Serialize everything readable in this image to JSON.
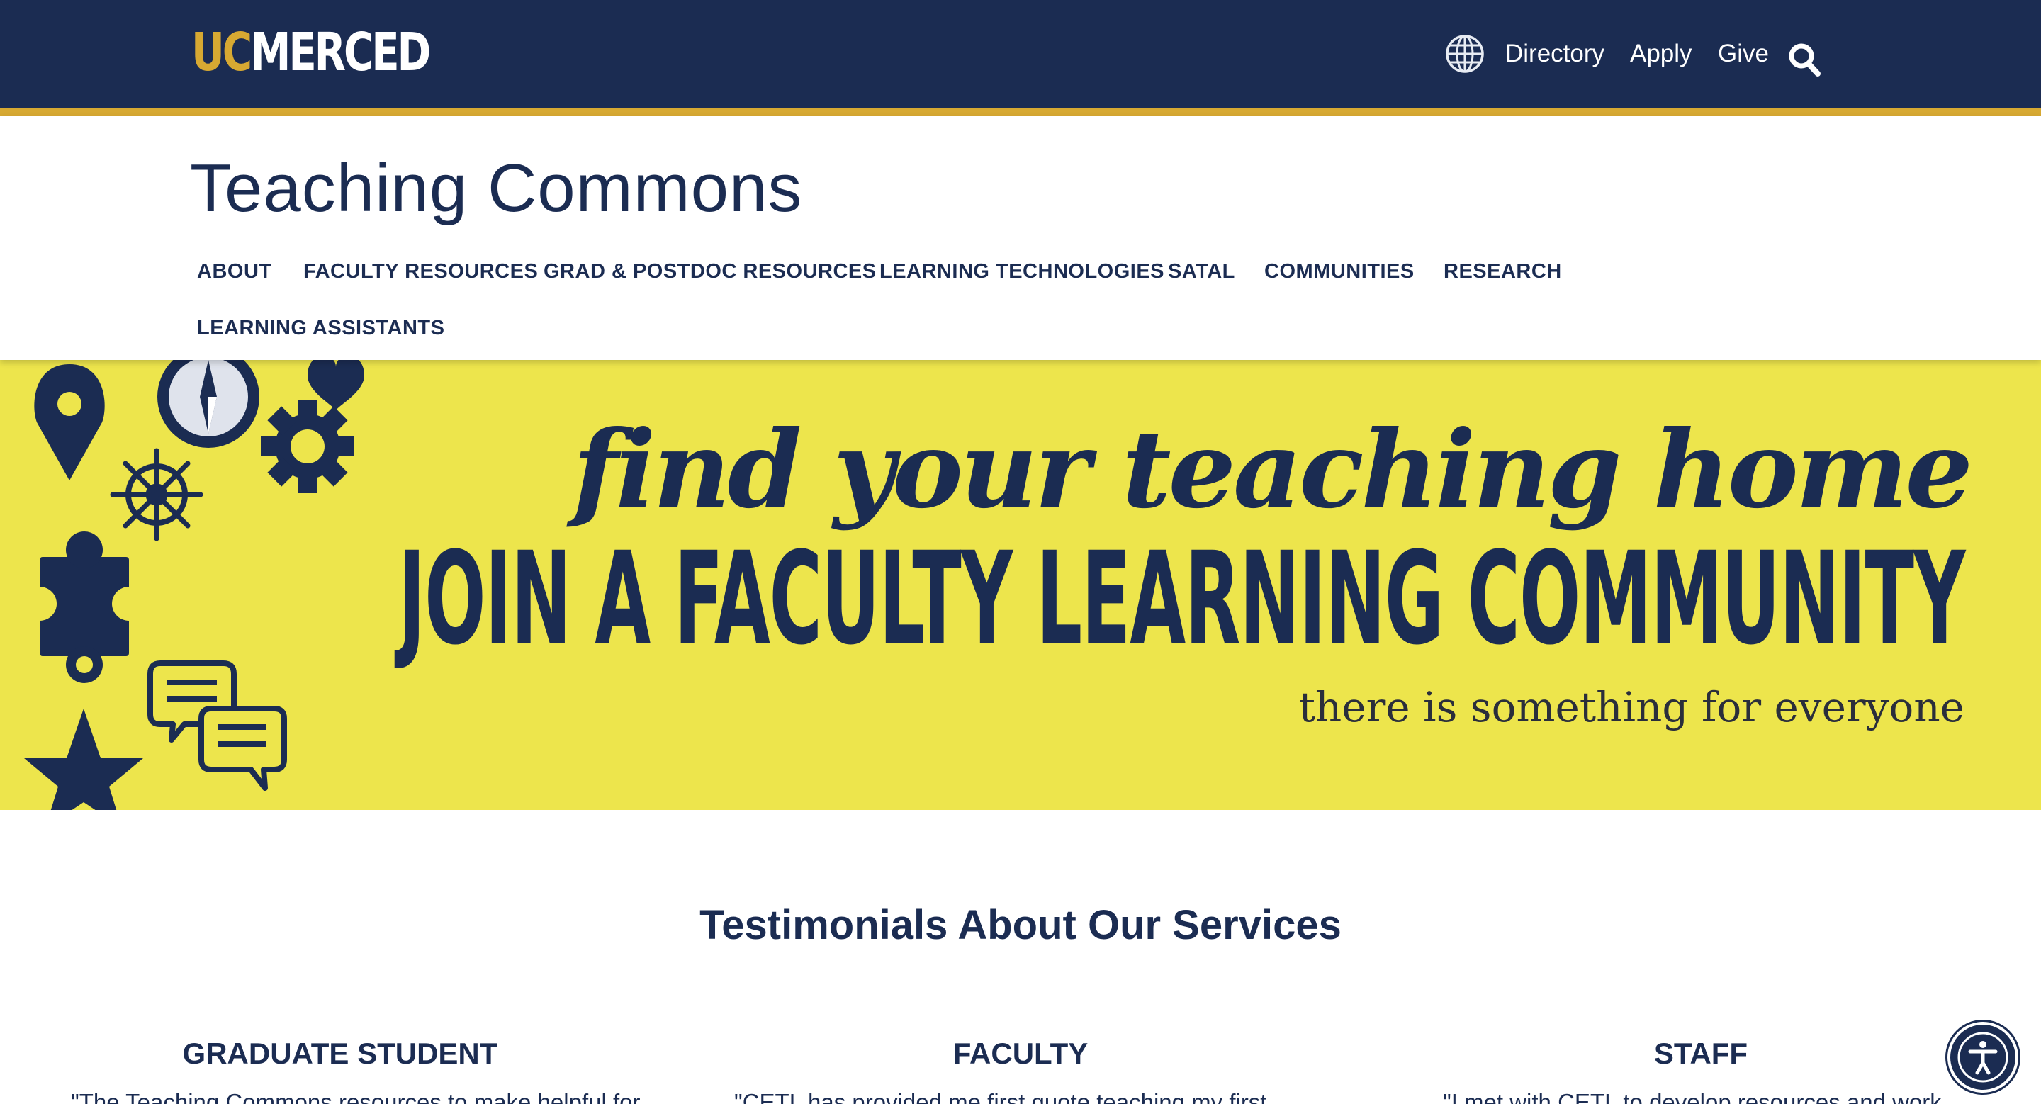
{
  "brand": {
    "uc": "UC",
    "merced": "MERCED"
  },
  "utility_nav": {
    "globe_icon": "globe-icon",
    "directory": "Directory",
    "apply": "Apply",
    "give": "Give",
    "search_icon": "search-icon"
  },
  "site": {
    "title": "Teaching Commons"
  },
  "main_nav": [
    {
      "label": "ABOUT"
    },
    {
      "label": "FACULTY RESOURCES"
    },
    {
      "label": "GRAD & POSTDOC RESOURCES"
    },
    {
      "label": "LEARNING TECHNOLOGIES"
    },
    {
      "label": "SATAL"
    },
    {
      "label": "COMMUNITIES"
    },
    {
      "label": "RESEARCH"
    },
    {
      "label": "LEARNING ASSISTANTS"
    }
  ],
  "hero": {
    "script_line": "find your teaching home",
    "main_line": "JOIN A FACULTY LEARNING COMMUNITY",
    "sub_line": "there is something for everyone",
    "background_color": "#ede54c",
    "icon_names": [
      "map-pin-icon",
      "compass-icon",
      "heart-icon",
      "gear-icon",
      "ship-wheel-icon",
      "puzzle-piece-icon",
      "chat-bubbles-icon",
      "star-icon"
    ]
  },
  "testimonials": {
    "title": "Testimonials About Our Services",
    "columns": [
      {
        "heading": "GRADUATE STUDENT",
        "quote_start": "\"The Teaching Commons resources to make helpful for"
      },
      {
        "heading": "FACULTY",
        "quote_start": "\"CETL has provided me first quote teaching my first"
      },
      {
        "heading": "STAFF",
        "quote_start": "\"I met with CETL to develop resources and work"
      }
    ]
  },
  "accessibility": {
    "icon": "accessibility-icon"
  },
  "colors": {
    "navy": "#1b2c52",
    "gold": "#d7a932",
    "yellow": "#ede54c"
  }
}
